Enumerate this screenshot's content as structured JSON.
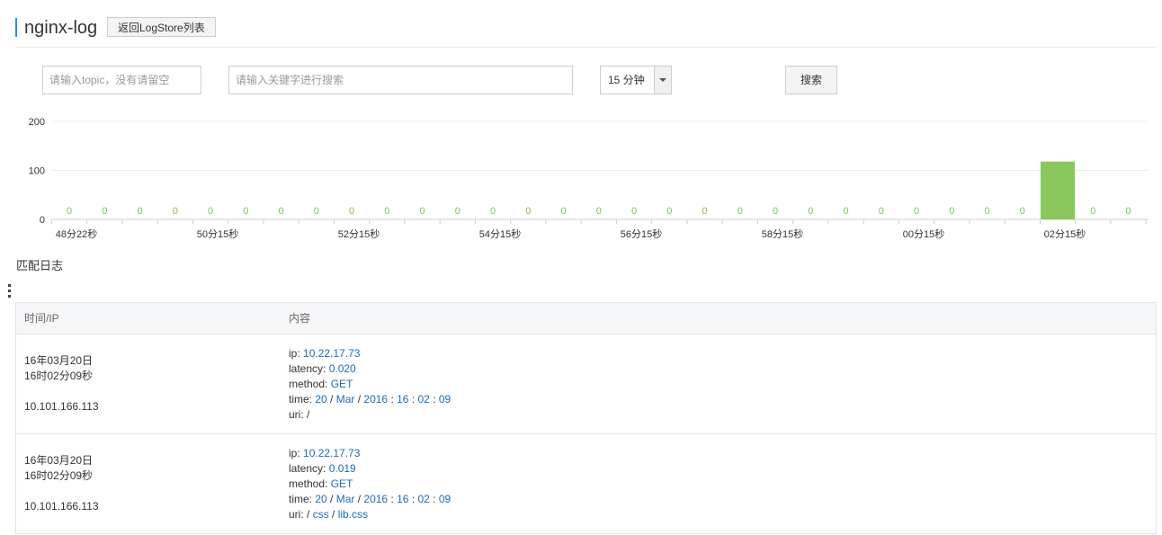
{
  "header": {
    "title": "nginx-log",
    "back_button": "返回LogStore列表"
  },
  "search": {
    "topic_placeholder": "请输入topic，没有请留空",
    "keyword_placeholder": "请输入关键字进行搜索",
    "range_value": "15 分钟",
    "button": "搜索"
  },
  "chart_data": {
    "type": "bar",
    "x": [
      "48分22秒",
      "",
      "",
      "",
      "50分15秒",
      "",
      "",
      "",
      "52分15秒",
      "",
      "",
      "",
      "54分15秒",
      "",
      "",
      "",
      "56分15秒",
      "",
      "",
      "",
      "58分15秒",
      "",
      "",
      "",
      "00分15秒",
      "",
      "",
      "",
      "02分15秒",
      "",
      ""
    ],
    "values": [
      0,
      0,
      0,
      0,
      0,
      0,
      0,
      0,
      0,
      0,
      0,
      0,
      0,
      0,
      0,
      0,
      0,
      0,
      0,
      0,
      0,
      0,
      0,
      0,
      0,
      0,
      0,
      0,
      118,
      0,
      0
    ],
    "yticks": [
      0,
      100,
      200
    ],
    "ylim": [
      0,
      200
    ],
    "bar_color": "#8ac85e",
    "label_color": "#7cc35c"
  },
  "section_title": "匹配日志",
  "table": {
    "headers": {
      "time_ip": "时间/IP",
      "content": "内容"
    },
    "rows": [
      {
        "date": "16年03月20日",
        "time": "16时02分09秒",
        "ip": "10.101.166.113",
        "ip_key": "ip",
        "ip_val": "10.22.17.73",
        "latency_key": "latency",
        "latency_val": "0.020",
        "method_key": "method",
        "method_val": "GET",
        "time_key": "time",
        "t_day": "20",
        "t_mon": "Mar",
        "t_year": "2016",
        "t_h": "16",
        "t_m": "02",
        "t_s": "09",
        "uri_key": "uri",
        "uri_parts": []
      },
      {
        "date": "16年03月20日",
        "time": "16时02分09秒",
        "ip": "10.101.166.113",
        "ip_key": "ip",
        "ip_val": "10.22.17.73",
        "latency_key": "latency",
        "latency_val": "0.019",
        "method_key": "method",
        "method_val": "GET",
        "time_key": "time",
        "t_day": "20",
        "t_mon": "Mar",
        "t_year": "2016",
        "t_h": "16",
        "t_m": "02",
        "t_s": "09",
        "uri_key": "uri",
        "uri_parts": [
          "css",
          "lib.css"
        ]
      }
    ]
  }
}
